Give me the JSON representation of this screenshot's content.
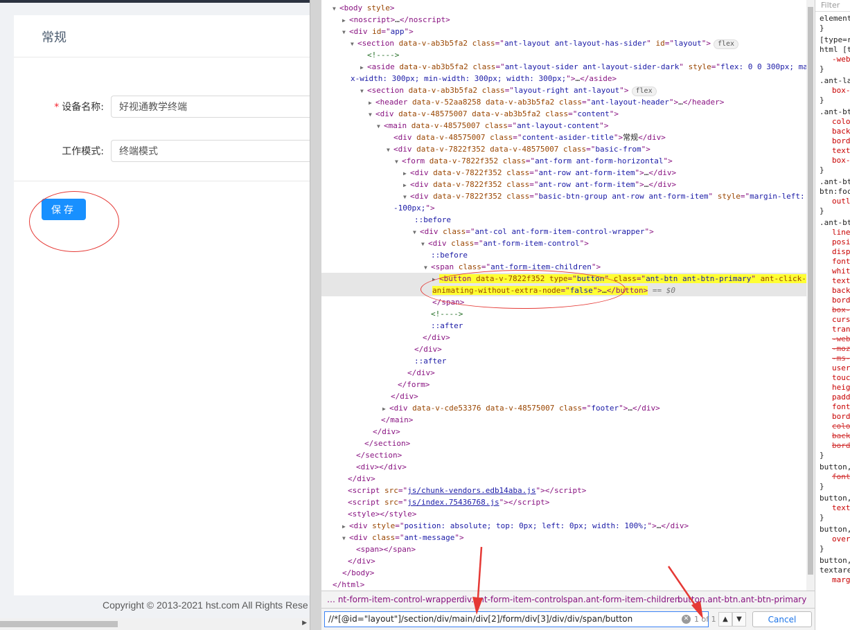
{
  "app": {
    "card_title": "常规",
    "form": [
      {
        "label": "设备名称",
        "required": true,
        "value": "好视通教学终端"
      },
      {
        "label": "工作模式",
        "required": false,
        "value": "终端模式"
      }
    ],
    "save_label": "保存",
    "required_mark": "*",
    "copyright": "Copyright © 2013-2021 hst.com All Rights Rese"
  },
  "devtools": {
    "styles_filter_placeholder": "Filter",
    "dom_lines": [
      {
        "html": "<span class='tri'>▼</span><span class='tg'>&lt;body </span><span class='an'>style</span><span class='tg'>&gt;</span>"
      },
      {
        "html": "<span class='tri'>▶</span><span class='tg'>&lt;noscript&gt;</span><span class='tx'>…</span><span class='tg'>&lt;/noscript&gt;</span>"
      },
      {
        "html": "<span class='tri'>▼</span><span class='tg'>&lt;div </span><span class='an'>id</span><span class='tg'>=\"</span><span class='av'>app</span><span class='tg'>\"&gt;</span>"
      },
      {
        "html": "<span class='tri'>▼</span><span class='tg'>&lt;section </span><span class='an'>data-v-ab3b5fa2 class</span><span class='tg'>=\"</span><span class='av'>ant-layout ant-layout-has-sider</span><span class='tg'>\" </span><span class='an'>id</span><span class='tg'>=\"</span><span class='av'>layout</span><span class='tg'>\"&gt;</span><span class='badge'>flex</span>"
      },
      {
        "html": "<span class='tri'></span><span class='cm'>&lt;!----&gt;</span>"
      },
      {
        "html": "<span class='tri'>▶</span><span class='tg'>&lt;aside </span><span class='an'>data-v-ab3b5fa2 class</span><span class='tg'>=\"</span><span class='av'>ant-layout-sider ant-layout-sider-dark</span><span class='tg'>\" </span><span class='an'>style</span><span class='tg'>=\"</span><span class='av'>flex: 0 0 300px; ma</span>"
      },
      {
        "html": "<span class='av'>x-width: 300px; min-width: 300px; width: 300px;</span><span class='tg'>\"&gt;</span><span class='tx'>…</span><span class='tg'>&lt;/aside&gt;</span>"
      },
      {
        "html": "<span class='tri'>▼</span><span class='tg'>&lt;section </span><span class='an'>data-v-ab3b5fa2 class</span><span class='tg'>=\"</span><span class='av'>layout-right ant-layout</span><span class='tg'>\"&gt;</span><span class='badge'>flex</span>"
      },
      {
        "html": "<span class='tri'>▶</span><span class='tg'>&lt;header </span><span class='an'>data-v-52aa8258 data-v-ab3b5fa2 class</span><span class='tg'>=\"</span><span class='av'>ant-layout-header</span><span class='tg'>\"&gt;</span><span class='tx'>…</span><span class='tg'>&lt;/header&gt;</span>"
      },
      {
        "html": "<span class='tri'>▼</span><span class='tg'>&lt;div </span><span class='an'>data-v-48575007 data-v-ab3b5fa2 class</span><span class='tg'>=\"</span><span class='av'>content</span><span class='tg'>\"&gt;</span>"
      },
      {
        "html": "<span class='tri'>▼</span><span class='tg'>&lt;main </span><span class='an'>data-v-48575007 class</span><span class='tg'>=\"</span><span class='av'>ant-layout-content</span><span class='tg'>\"&gt;</span>"
      },
      {
        "html": "<span class='tri'></span><span class='tg'>&lt;div </span><span class='an'>data-v-48575007 class</span><span class='tg'>=\"</span><span class='av'>content-asider-title</span><span class='tg'>\"&gt;</span><span class='tx'>常规</span><span class='tg'>&lt;/div&gt;</span>"
      },
      {
        "html": "<span class='tri'>▼</span><span class='tg'>&lt;div </span><span class='an'>data-v-7822f352 data-v-48575007 class</span><span class='tg'>=\"</span><span class='av'>basic-from</span><span class='tg'>\"&gt;</span>"
      },
      {
        "html": "<span class='tri'>▼</span><span class='tg'>&lt;form </span><span class='an'>data-v-7822f352 class</span><span class='tg'>=\"</span><span class='av'>ant-form ant-form-horizontal</span><span class='tg'>\"&gt;</span>"
      },
      {
        "html": "<span class='tri'>▶</span><span class='tg'>&lt;div </span><span class='an'>data-v-7822f352 class</span><span class='tg'>=\"</span><span class='av'>ant-row ant-form-item</span><span class='tg'>\"&gt;</span><span class='tx'>…</span><span class='tg'>&lt;/div&gt;</span>"
      },
      {
        "html": "<span class='tri'>▶</span><span class='tg'>&lt;div </span><span class='an'>data-v-7822f352 class</span><span class='tg'>=\"</span><span class='av'>ant-row ant-form-item</span><span class='tg'>\"&gt;</span><span class='tx'>…</span><span class='tg'>&lt;/div&gt;</span>"
      },
      {
        "html": "<span class='tri'>▼</span><span class='tg'>&lt;div </span><span class='an'>data-v-7822f352 class</span><span class='tg'>=\"</span><span class='av'>basic-btn-group ant-row ant-form-item</span><span class='tg'>\" </span><span class='an'>style</span><span class='tg'>=\"</span><span class='av'>margin-left:</span>"
      },
      {
        "html": "<span class='av'>-100px;</span><span class='tg'>\"&gt;</span>"
      },
      {
        "html": "<span class='ps'>::before</span>"
      },
      {
        "html": "<span class='tri'>▼</span><span class='tg'>&lt;div </span><span class='an'>class</span><span class='tg'>=\"</span><span class='av'>ant-col ant-form-item-control-wrapper</span><span class='tg'>\"&gt;</span>"
      },
      {
        "html": "<span class='tri'>▼</span><span class='tg'>&lt;div </span><span class='an'>class</span><span class='tg'>=\"</span><span class='av'>ant-form-item-control</span><span class='tg'>\"&gt;</span>"
      },
      {
        "html": "<span class='ps'>::before</span>"
      },
      {
        "html": "<span class='tri'>▼</span><span class='tg'>&lt;span </span><span class='an'>class</span><span class='tg'>=\"</span><span class='av'>ant-form-item-children</span><span class='tg'>\"&gt;</span>"
      },
      {
        "html": "<span class='tri'>▶</span><span class='hl'><span class='tg'>&lt;button </span><span class='an'>data-v-7822f352 type</span><span class='tg'>=\"</span><span class='av'>button</span><span class='tg'>\" </span><span class='an'>class</span><span class='tg'>=\"</span><span class='av'>ant-btn ant-btn-primary</span><span class='tg'>\" </span><span class='an'>ant-click-</span></span>"
      },
      {
        "html": "<span class='hl'><span class='an'>animating-without-extra-node</span><span class='tg'>=\"</span><span class='av'>false</span><span class='tg'>\"&gt;</span><span class='tx'>…</span><span class='tg'>&lt;/button&gt;</span></span><span class='dollar'> == $0</span>"
      },
      {
        "html": "<span class='tg'>&lt;/span&gt;</span>"
      },
      {
        "html": "<span class='cm'>&lt;!----&gt;</span>"
      },
      {
        "html": "<span class='ps'>::after</span>"
      },
      {
        "html": "<span class='tg'>&lt;/div&gt;</span>"
      },
      {
        "html": "<span class='tg'>&lt;/div&gt;</span>"
      },
      {
        "html": "<span class='ps'>::after</span>"
      },
      {
        "html": "<span class='tg'>&lt;/div&gt;</span>"
      },
      {
        "html": "<span class='tg'>&lt;/form&gt;</span>"
      },
      {
        "html": "<span class='tg'>&lt;/div&gt;</span>"
      },
      {
        "html": "<span class='tri'>▶</span><span class='tg'>&lt;div </span><span class='an'>data-v-cde53376 data-v-48575007 class</span><span class='tg'>=\"</span><span class='av'>footer</span><span class='tg'>\"&gt;</span><span class='tx'>…</span><span class='tg'>&lt;/div&gt;</span>"
      },
      {
        "html": "<span class='tg'>&lt;/main&gt;</span>"
      },
      {
        "html": "<span class='tg'>&lt;/div&gt;</span>"
      },
      {
        "html": "<span class='tg'>&lt;/section&gt;</span>"
      },
      {
        "html": "<span class='tg'>&lt;/section&gt;</span>"
      },
      {
        "html": "<span class='tg'>&lt;div&gt;&lt;/div&gt;</span>"
      },
      {
        "html": "<span class='tg'>&lt;/div&gt;</span>"
      },
      {
        "html": "<span class='tg'>&lt;script </span><span class='an'>src</span><span class='tg'>=\"</span><span class='lk'>js/chunk-vendors.edb14aba.js</span><span class='tg'>\"&gt;&lt;/script&gt;</span>"
      },
      {
        "html": "<span class='tg'>&lt;script </span><span class='an'>src</span><span class='tg'>=\"</span><span class='lk'>js/index.75436768.js</span><span class='tg'>\"&gt;&lt;/script&gt;</span>"
      },
      {
        "html": "<span class='tg'>&lt;style&gt;&lt;/style&gt;</span>"
      },
      {
        "html": "<span class='tri'>▶</span><span class='tg'>&lt;div </span><span class='an'>style</span><span class='tg'>=\"</span><span class='av'>position: absolute; top: 0px; left: 0px; width: 100%;</span><span class='tg'>\"&gt;</span><span class='tx'>…</span><span class='tg'>&lt;/div&gt;</span>"
      },
      {
        "html": "<span class='tri'>▼</span><span class='tg'>&lt;div </span><span class='an'>class</span><span class='tg'>=\"</span><span class='av'>ant-message</span><span class='tg'>\"&gt;</span>"
      },
      {
        "html": "<span class='tg'>&lt;span&gt;&lt;/span&gt;</span>"
      },
      {
        "html": "<span class='tg'>&lt;/div&gt;</span>"
      },
      {
        "html": "<span class='tg'>&lt;/body&gt;</span>"
      },
      {
        "html": "<span class='tg'>&lt;/html&gt;</span>"
      }
    ],
    "breadcrumbs": [
      "… nt-form-item-control-wrapper",
      "div.ant-form-item-control",
      "span.ant-form-item-children",
      "button.ant-btn.ant-btn-primary"
    ],
    "find_query": "//*[@id=\"layout\"]/section/div/main/div[2]/form/div[3]/div/div/span/button",
    "find_count": "1 of 1",
    "find_cancel": "Cancel",
    "styles_lines": [
      "element",
      "}",
      "[type=r",
      "html [t",
      "-web",
      "}",
      ".ant-la",
      "box-",
      "}",
      ".ant-bt",
      "colo",
      "back",
      "bord",
      "text",
      "box-",
      "}",
      ".ant-bt",
      "btn:foc",
      "outl",
      "}",
      ".ant-bt",
      "line",
      "posi",
      "disp",
      "font",
      "whit",
      "text",
      "back",
      "bord",
      "box-",
      "curs",
      "tran",
      "-web",
      "-moz",
      "-ms-",
      "user",
      "touc",
      "heig",
      "padd",
      "font",
      "bord",
      "colo",
      "back",
      "bord",
      "}",
      "button,",
      "font",
      "}",
      "button,",
      "text",
      "}",
      "button,",
      "over",
      "}",
      "button,",
      "textare",
      "marg"
    ]
  }
}
